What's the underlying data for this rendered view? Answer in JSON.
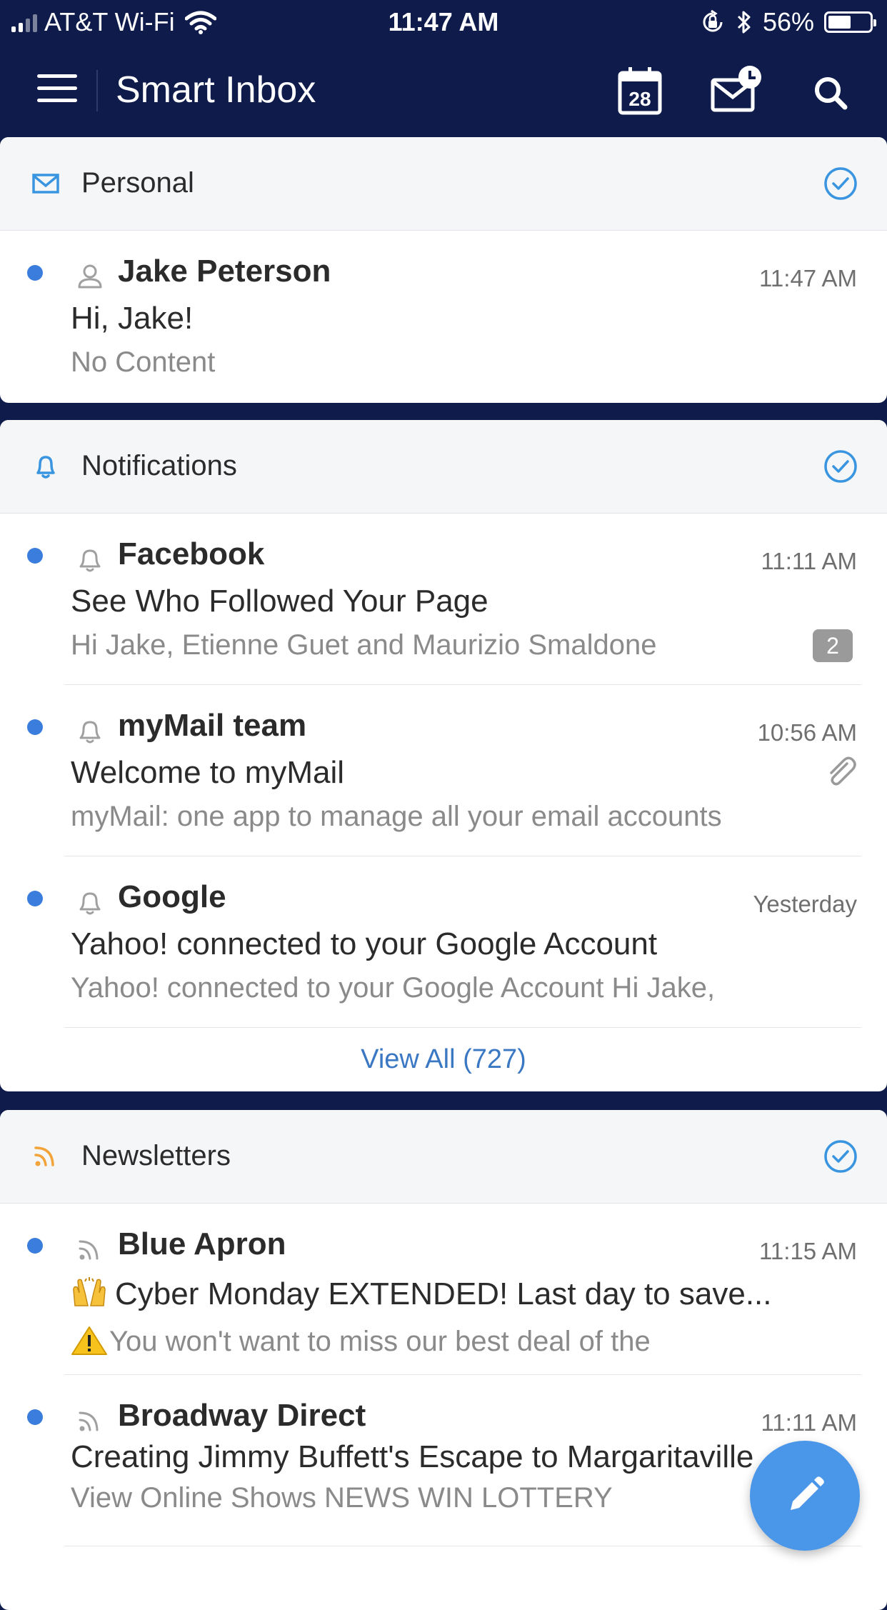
{
  "status": {
    "carrier": "AT&T Wi-Fi",
    "time": "11:47 AM",
    "battery": "56%",
    "battery_level": 0.56
  },
  "header": {
    "title": "Smart Inbox",
    "calendar_day": "28",
    "icons": [
      "menu-icon",
      "calendar-icon",
      "scheduled-mail-icon",
      "search-icon"
    ]
  },
  "colors": {
    "header_bg": "#0f1c4b",
    "unread_dot": "#3b7ddd",
    "accent": "#3a95e0",
    "rss": "#f2a33a",
    "fab": "#4a97ea"
  },
  "sections": {
    "personal": {
      "title": "Personal",
      "icon": "envelope-icon",
      "messages": [
        {
          "sender": "Jake Peterson",
          "time": "11:47 AM",
          "subject": "Hi, Jake!",
          "preview": "No Content",
          "icon": "person-icon",
          "unread": true
        }
      ]
    },
    "notifications": {
      "title": "Notifications",
      "icon": "bell-icon",
      "messages": [
        {
          "sender": "Facebook",
          "time": "11:11 AM",
          "subject": "See Who Followed Your Page",
          "preview": "Hi Jake, Etienne Guet and Maurizio Smaldone",
          "badge": "2",
          "icon": "bell-icon",
          "unread": true
        },
        {
          "sender": "myMail team",
          "time": "10:56 AM",
          "subject": "Welcome to myMail",
          "preview": "myMail: one app to manage all your email accounts",
          "icon": "bell-icon",
          "attachment_icon": "paperclip-icon",
          "unread": true
        },
        {
          "sender": "Google",
          "time": "Yesterday",
          "subject": "Yahoo! connected to your Google Account",
          "preview": "Yahoo! connected to your Google Account Hi Jake,",
          "icon": "bell-icon",
          "unread": true
        }
      ],
      "view_all": "View All (727)"
    },
    "newsletters": {
      "title": "Newsletters",
      "icon": "rss-icon",
      "messages": [
        {
          "sender": "Blue Apron",
          "time": "11:15 AM",
          "subject": "Cyber Monday EXTENDED! Last day to save...",
          "preview": "You won't want to miss our best deal of the",
          "subject_emoji": "raised-hands-icon",
          "preview_emoji": "warning-icon",
          "icon": "rss-icon",
          "unread": true
        },
        {
          "sender": "Broadway Direct",
          "time": "11:11 AM",
          "subject": "Creating Jimmy Buffett's Escape to Margaritaville",
          "preview": "View Online Shows NEWS WIN LOTTERY",
          "icon": "rss-icon",
          "unread": true
        }
      ]
    }
  },
  "compose": {
    "icon": "pencil-icon"
  }
}
